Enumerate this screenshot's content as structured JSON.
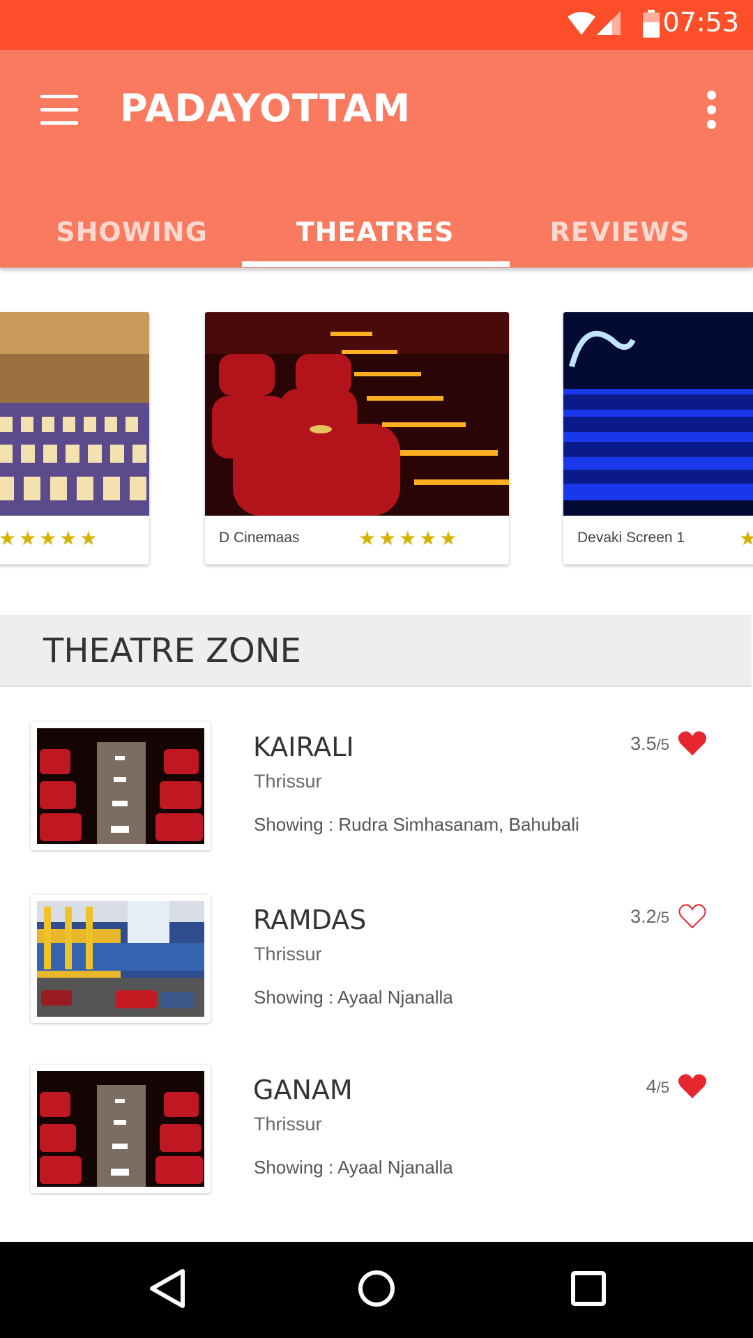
{
  "status_bar": {
    "time": "07:53",
    "icons": [
      "wifi-icon",
      "signal-icon",
      "battery-icon"
    ]
  },
  "app_bar": {
    "title": "PADAYOTTAM",
    "menu_icon": "hamburger-menu-icon",
    "overflow_icon": "more-vert-icon"
  },
  "tabs": [
    {
      "label": "SHOWING",
      "selected": false
    },
    {
      "label": "THEATRES",
      "selected": true
    },
    {
      "label": "REVIEWS",
      "selected": false
    }
  ],
  "featured": [
    {
      "name": "",
      "stars": "★★★★★"
    },
    {
      "name": "D Cinemaas",
      "stars": "★★★★★"
    },
    {
      "name": "Devaki Screen 1",
      "stars": "★"
    }
  ],
  "section": {
    "title": "THEATRE ZONE"
  },
  "theatres": [
    {
      "name": "KAIRALI",
      "city": "Thrissur",
      "showing": "Showing : Rudra Simhasanam, Bahubali",
      "rating": "3.5",
      "scale": "/5",
      "favorite": true
    },
    {
      "name": "RAMDAS",
      "city": "Thrissur",
      "showing": "Showing : Ayaal Njanalla",
      "rating": "3.2",
      "scale": "/5",
      "favorite": false
    },
    {
      "name": "GANAM",
      "city": "Thrissur",
      "showing": "Showing : Ayaal Njanalla",
      "rating": "4",
      "scale": "/5",
      "favorite": true
    }
  ],
  "colors": {
    "status_bar": "#FF4F2A",
    "app_bar": "#FA7A60",
    "heart": "#E8262F",
    "star": "#D4B300"
  },
  "nav": {
    "back": "back-icon",
    "home": "home-icon",
    "recents": "recents-icon"
  }
}
